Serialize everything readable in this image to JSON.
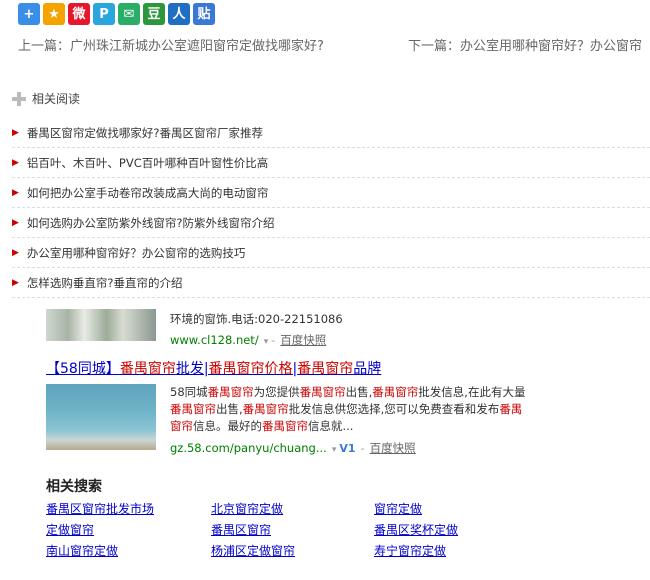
{
  "share": {
    "icons": [
      {
        "name": "plus-share-icon",
        "glyph": "+",
        "color": "#3a8ee6"
      },
      {
        "name": "star-favorite-icon",
        "glyph": "★",
        "color": "#f4a300"
      },
      {
        "name": "weibo-icon",
        "glyph": "微",
        "color": "#e6162d"
      },
      {
        "name": "p-share-icon",
        "glyph": "P",
        "color": "#2aa6df"
      },
      {
        "name": "wechat-icon",
        "glyph": "✉",
        "color": "#2aae67"
      },
      {
        "name": "douban-icon",
        "glyph": "豆",
        "color": "#2e963d"
      },
      {
        "name": "renren-icon",
        "glyph": "人",
        "color": "#1e6fc2"
      },
      {
        "name": "tieba-icon",
        "glyph": "贴",
        "color": "#3a78d6"
      }
    ]
  },
  "nav": {
    "prev": "上一篇：广州珠江新城办公室遮阳窗帘定做找哪家好?",
    "next": "下一篇：办公室用哪种窗帘好？办公窗帘"
  },
  "related": {
    "title": "相关阅读",
    "items": [
      "番禺区窗帘定做找哪家好?番禺区窗帘厂家推荐",
      "铝百叶、木百叶、PVC百叶哪种百叶窗性价比高",
      "如何把办公室手动卷帘改装成高大尚的电动窗帘",
      "如何选购办公室防紫外线窗帘?防紫外线窗帘介绍",
      "办公室用哪种窗帘好？办公窗帘的选购技巧",
      "怎样选购垂直帘?垂直帘的介绍"
    ]
  },
  "ad1": {
    "desc": "环境的窗饰.电话:020-22151086",
    "url": "www.cl128.net/",
    "snapshot": "百度快照"
  },
  "ad2": {
    "title_parts": [
      {
        "t": "【58同城】",
        "hl": false
      },
      {
        "t": "番禺窗帘",
        "hl": true
      },
      {
        "t": "批发|",
        "hl": false
      },
      {
        "t": "番禺窗帘价格",
        "hl": true
      },
      {
        "t": "|",
        "hl": false
      },
      {
        "t": "番禺窗帘",
        "hl": true
      },
      {
        "t": "品牌",
        "hl": false
      }
    ],
    "text_parts": [
      {
        "t": "58同城",
        "hl": false
      },
      {
        "t": "番禺窗帘",
        "hl": true
      },
      {
        "t": "为您提供",
        "hl": false
      },
      {
        "t": "番禺窗帘",
        "hl": true
      },
      {
        "t": "出售,",
        "hl": false
      },
      {
        "t": "番禺窗帘",
        "hl": true
      },
      {
        "t": "批发信息,在此有大量",
        "hl": false
      },
      {
        "t": "番禺窗帘",
        "hl": true
      },
      {
        "t": "出售,",
        "hl": false
      },
      {
        "t": "番禺窗帘",
        "hl": true
      },
      {
        "t": "批发信息供您选择,您可以免费查看和发布",
        "hl": false
      },
      {
        "t": "番禺窗帘",
        "hl": true
      },
      {
        "t": "信息。最好的",
        "hl": false
      },
      {
        "t": "番禺窗帘",
        "hl": true
      },
      {
        "t": "信息就...",
        "hl": false
      }
    ],
    "url": "gz.58.com/panyu/chuang...",
    "badge": "V1",
    "snapshot": "百度快照"
  },
  "related_search": {
    "title": "相关搜索",
    "links": [
      "番禺区窗帘批发市场",
      "北京窗帘定做",
      "窗帘定做",
      "定做窗帘",
      "番禺区窗帘",
      "番禺区奖杯定做",
      "南山窗帘定做",
      "杨浦区定做窗帘",
      "寿宁窗帘定做"
    ]
  }
}
